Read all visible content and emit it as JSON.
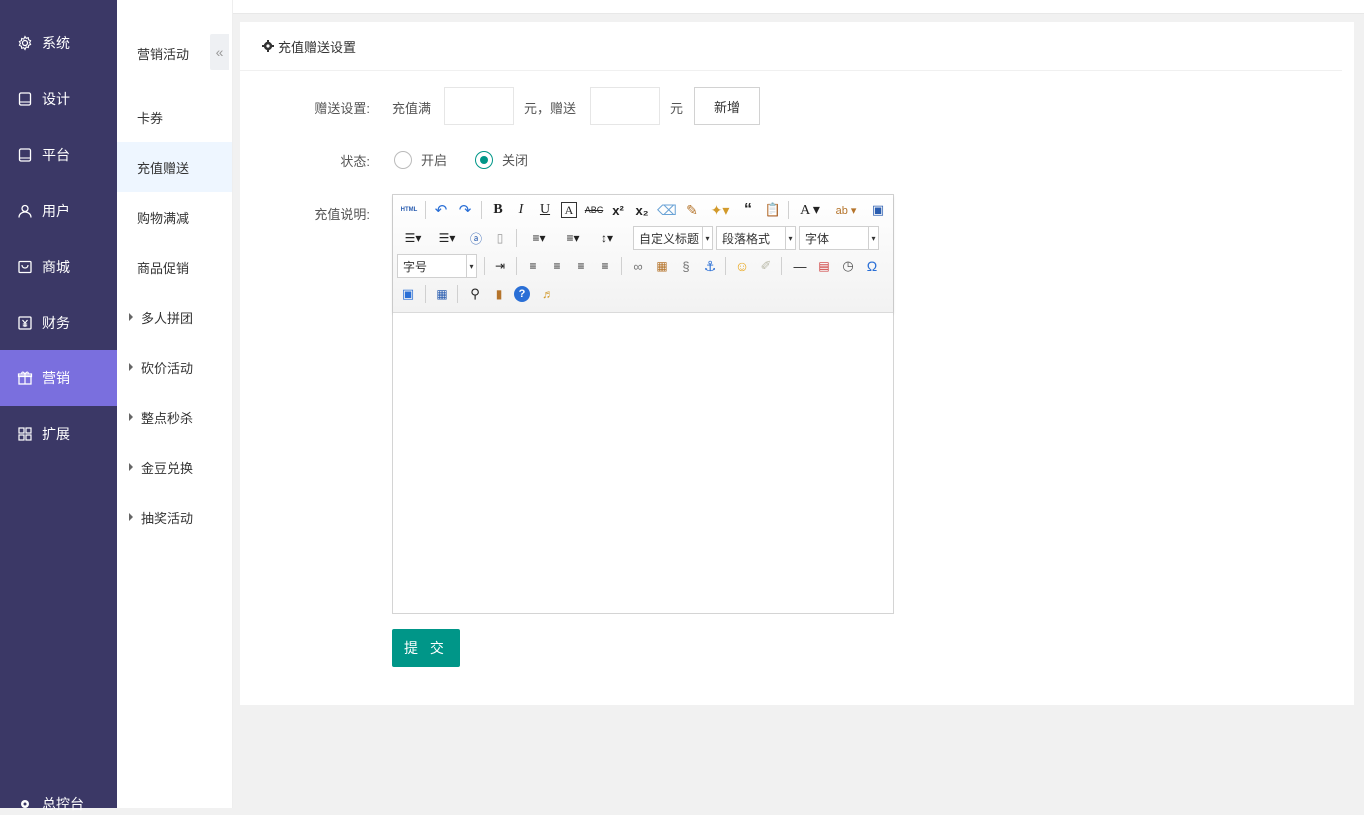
{
  "left_nav": {
    "items": [
      {
        "label": "系统",
        "icon": "gear-icon"
      },
      {
        "label": "设计",
        "icon": "monitor-icon"
      },
      {
        "label": "平台",
        "icon": "tablet-icon"
      },
      {
        "label": "用户",
        "icon": "user-icon"
      },
      {
        "label": "商城",
        "icon": "shop-icon"
      },
      {
        "label": "财务",
        "icon": "yen-icon"
      },
      {
        "label": "营销",
        "icon": "gift-icon"
      },
      {
        "label": "扩展",
        "icon": "grid-icon"
      }
    ],
    "active": "营销",
    "bottom_label": "总控台"
  },
  "sub_nav": {
    "title": "营销活动",
    "collapse_glyph": "«",
    "items": [
      {
        "label": "卡券"
      },
      {
        "label": "充值赠送"
      },
      {
        "label": "购物满减"
      },
      {
        "label": "商品促销"
      },
      {
        "label": "多人拼团"
      },
      {
        "label": "砍价活动"
      },
      {
        "label": "整点秒杀"
      },
      {
        "label": "金豆兑换"
      },
      {
        "label": "抽奖活动"
      }
    ],
    "active": "充值赠送"
  },
  "panel": {
    "title": "充值赠送设置"
  },
  "form": {
    "gift_label": "赠送设置:",
    "recharge_prefix": "充值满",
    "recharge_value": "",
    "middle_text": "元，赠送",
    "gift_value": "",
    "unit_text": "元",
    "add_button": "新增",
    "status_label": "状态:",
    "status_options": [
      "开启",
      "关闭"
    ],
    "status_selected": "关闭",
    "desc_label": "充值说明:",
    "submit_button": "提 交"
  },
  "editor": {
    "html_button": "HTML",
    "combo_title": "自定义标题",
    "combo_paragraph": "段落格式",
    "combo_font": "字体",
    "combo_size": "字号",
    "content": ""
  },
  "colors": {
    "nav_bg": "#3b3866",
    "nav_active": "#7a6fde",
    "accent": "#009688"
  }
}
